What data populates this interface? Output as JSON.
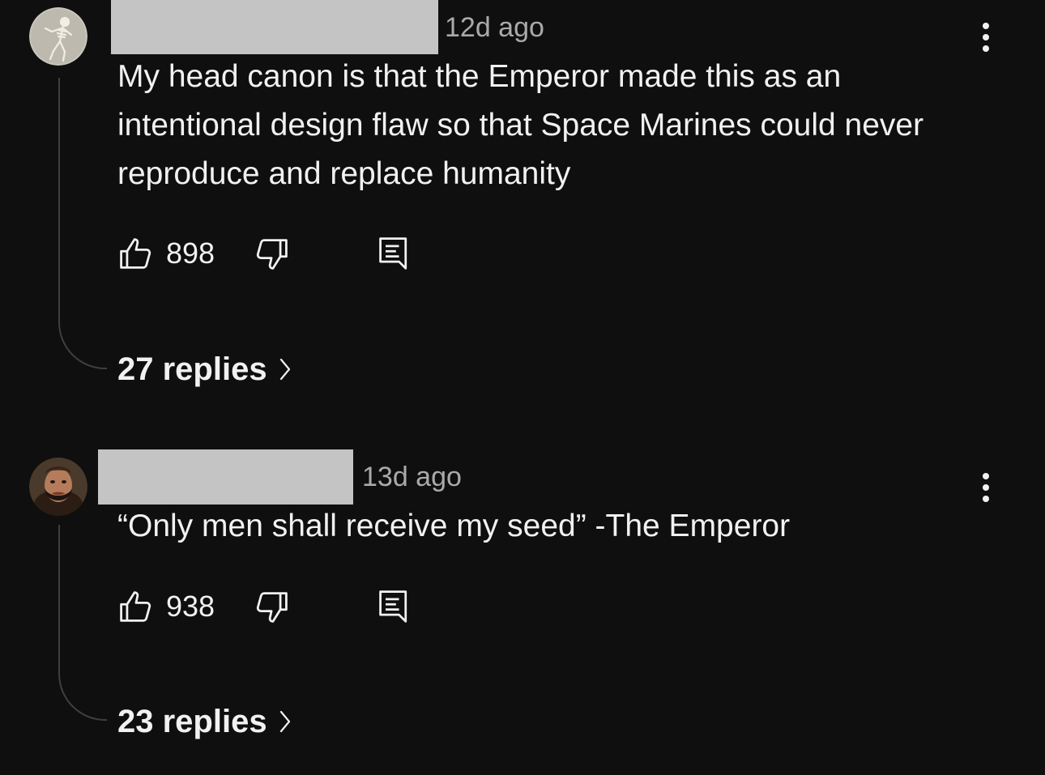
{
  "comments": [
    {
      "author": "",
      "time": "12d ago",
      "text": "My head canon is that the Emperor made this as an intentional design flaw so that Space Marines could never reproduce and replace humanity",
      "likes": "898",
      "replies": "27 replies",
      "avatar_icon": "skeleton-avatar-icon"
    },
    {
      "author": "",
      "time": "13d ago",
      "text": "“Only men shall receive my seed” -The Emperor",
      "likes": "938",
      "replies": "23 replies",
      "avatar_icon": "bearded-man-avatar-icon"
    }
  ],
  "icons": {
    "like": "thumbs-up-icon",
    "dislike": "thumbs-down-icon",
    "reply": "reply-comment-icon",
    "more": "more-vertical-icon",
    "chevron": "chevron-right-icon"
  },
  "colors": {
    "background": "#0f0f0f",
    "text": "#f1f1f1",
    "secondary_text": "#aaaaaa",
    "redaction": "#c4c4c4",
    "thread_line": "#3f3f3f"
  }
}
